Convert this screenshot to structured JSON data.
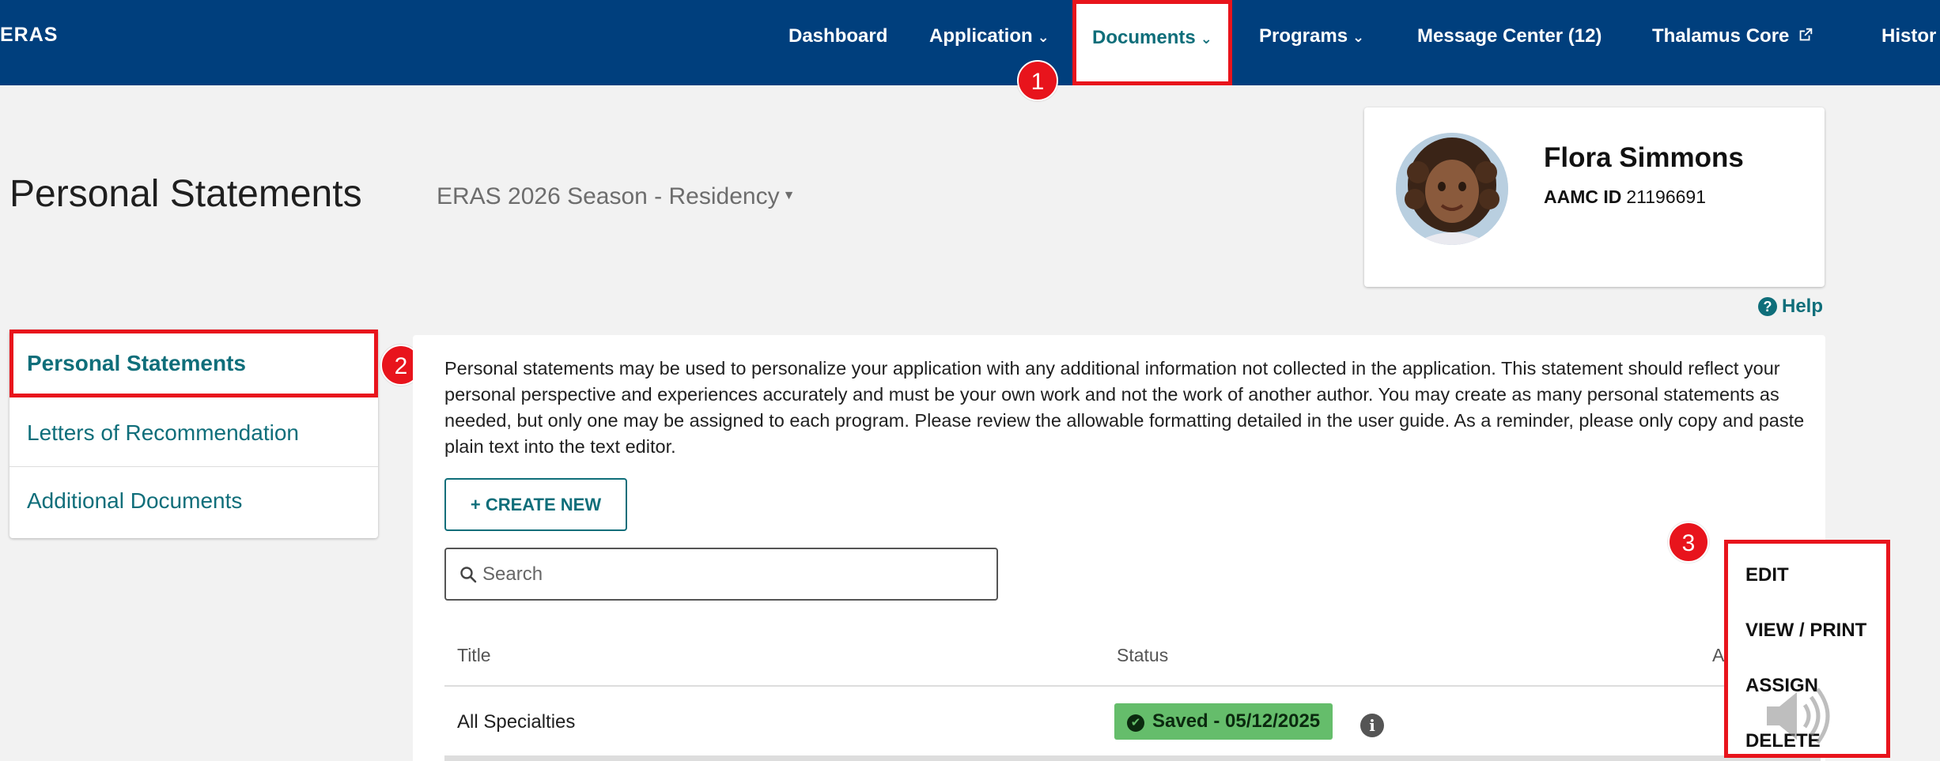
{
  "nav": {
    "brand": "ERAS",
    "items": [
      {
        "label": "Dashboard"
      },
      {
        "label": "Application"
      },
      {
        "label": "Documents"
      },
      {
        "label": "Programs"
      },
      {
        "label": "Message Center (12)"
      },
      {
        "label": "Thalamus Core"
      },
      {
        "label": "Histor"
      }
    ]
  },
  "callouts": [
    "1",
    "2",
    "3"
  ],
  "header": {
    "title": "Personal Statements",
    "season": "ERAS 2026 Season - Residency"
  },
  "profile": {
    "name": "Flora Simmons",
    "id_label": "AAMC ID",
    "id_value": "21196691"
  },
  "help": "Help",
  "sidebar": {
    "items": [
      {
        "label": "Personal Statements"
      },
      {
        "label": "Letters of Recommendation"
      },
      {
        "label": "Additional Documents"
      }
    ]
  },
  "main": {
    "intro": "Personal statements may be used to personalize your application with any additional information not collected in the application. This statement should reflect your personal perspective and experiences accurately and must be your own work and not the work of another author. You may create as many personal statements as needed, but only one may be assigned to each program. Please review the allowable formatting detailed in the user guide. As a reminder, please only copy and paste plain text into the text editor.",
    "create_label": "+ CREATE NEW",
    "search_placeholder": "Search",
    "columns": {
      "title": "Title",
      "status": "Status",
      "actions": "A"
    },
    "rows": [
      {
        "title": "All Specialties",
        "status": "Saved - 05/12/2025"
      }
    ]
  },
  "actions_menu": {
    "items": [
      {
        "label": "EDIT"
      },
      {
        "label": "VIEW / PRINT"
      },
      {
        "label": "ASSIGN"
      },
      {
        "label": "DELETE"
      }
    ]
  },
  "colors": {
    "nav_bg": "#003f7d",
    "accent_teal": "#0f6e7a",
    "highlight_red": "#e8141c",
    "status_green": "#65bd6b"
  }
}
